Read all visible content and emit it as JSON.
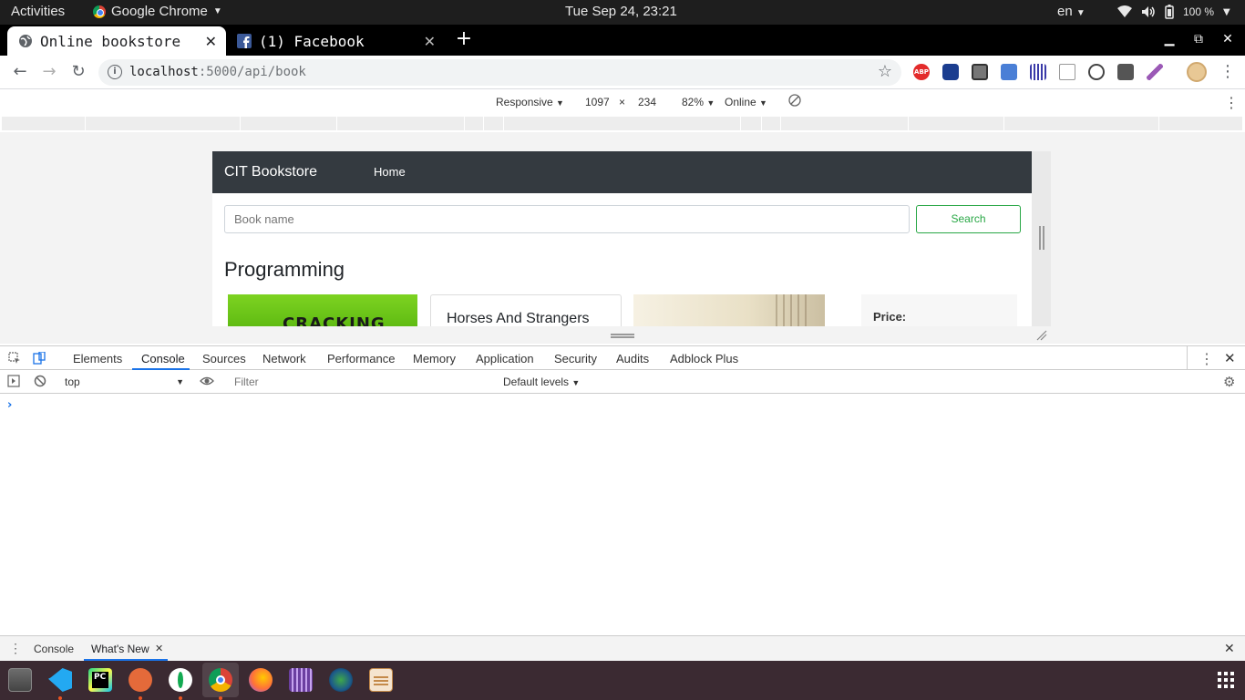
{
  "topbar": {
    "activities": "Activities",
    "app_name": "Google Chrome",
    "clock": "Tue Sep 24, 23:21",
    "language": "en",
    "battery": "100 %"
  },
  "tabs": [
    {
      "title": "Online bookstore",
      "close": "✕"
    },
    {
      "title": "(1) Facebook",
      "close": "✕"
    }
  ],
  "new_tab": "+",
  "window_controls": {
    "minimize": "▁",
    "restore": "⧉",
    "close": "✕"
  },
  "address": {
    "host": "localhost",
    "path": ":5000/api/book"
  },
  "extensions": {
    "abp": "ABP"
  },
  "device_toolbar": {
    "mode": "Responsive",
    "width": "1097",
    "times": "×",
    "height": "234",
    "zoom": "82%",
    "network": "Online"
  },
  "page": {
    "brand": "CIT Bookstore",
    "nav_home": "Home",
    "search_placeholder": "Book name",
    "search_button": "Search",
    "section_title": "Programming",
    "book1_cover_text": "CRACKING",
    "book2_title": "Horses And Strangers",
    "price_label": "Price:"
  },
  "devtools": {
    "tabs": [
      "Elements",
      "Console",
      "Sources",
      "Network",
      "Performance",
      "Memory",
      "Application",
      "Security",
      "Audits",
      "Adblock Plus"
    ],
    "active_tab": "Console",
    "context": "top",
    "filter_placeholder": "Filter",
    "levels": "Default levels",
    "prompt": "›",
    "drawer_tabs": [
      "Console",
      "What's New"
    ],
    "drawer_close": "✕"
  },
  "colors": {
    "navbar": "#343a40",
    "success": "#28a745",
    "devtools_accent": "#1a73e8",
    "dock": "#3b2a32"
  }
}
